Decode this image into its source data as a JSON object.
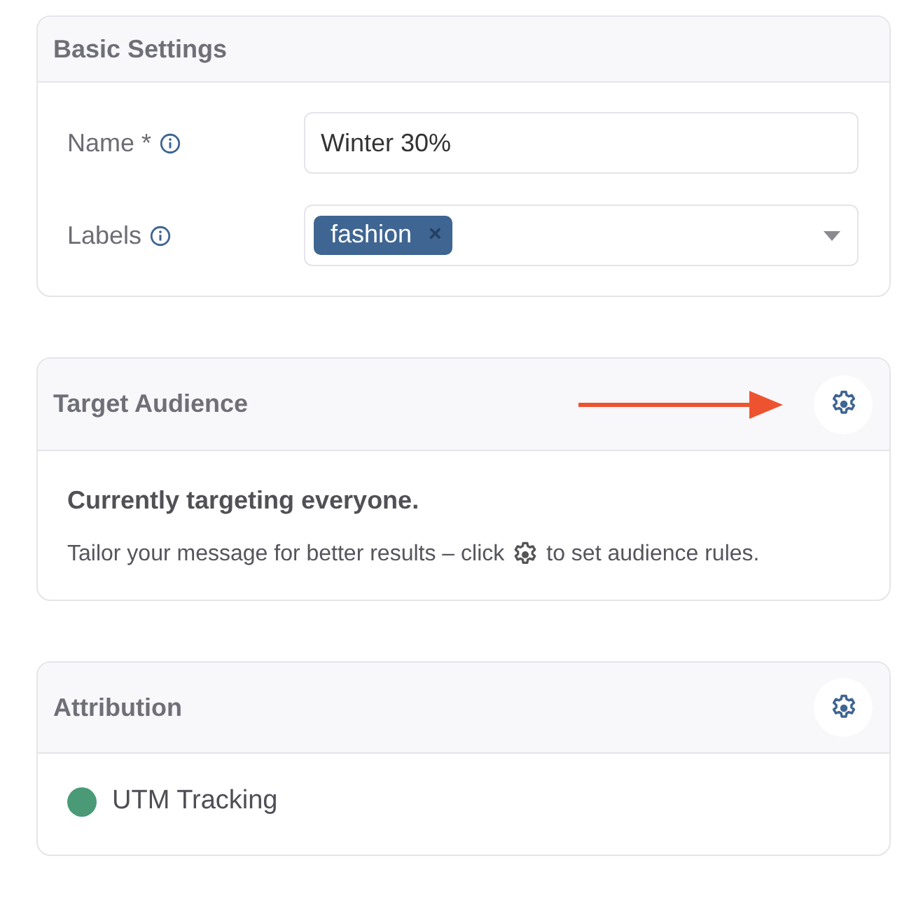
{
  "basic_settings": {
    "title": "Basic Settings",
    "fields": [
      {
        "kind": "text",
        "label": "Name *",
        "value": "Winter 30%"
      },
      {
        "kind": "tags",
        "label": "Labels",
        "tags": [
          "fashion"
        ],
        "remove": "×"
      }
    ]
  },
  "target_audience": {
    "title": "Target Audience",
    "heading": "Currently targeting everyone.",
    "hint_before": "Tailor your message for better results – click",
    "hint_after": "to set audience rules."
  },
  "attribution": {
    "title": "Attribution",
    "items": [
      {
        "label": "UTM Tracking",
        "color": "#4a9a78"
      }
    ]
  }
}
